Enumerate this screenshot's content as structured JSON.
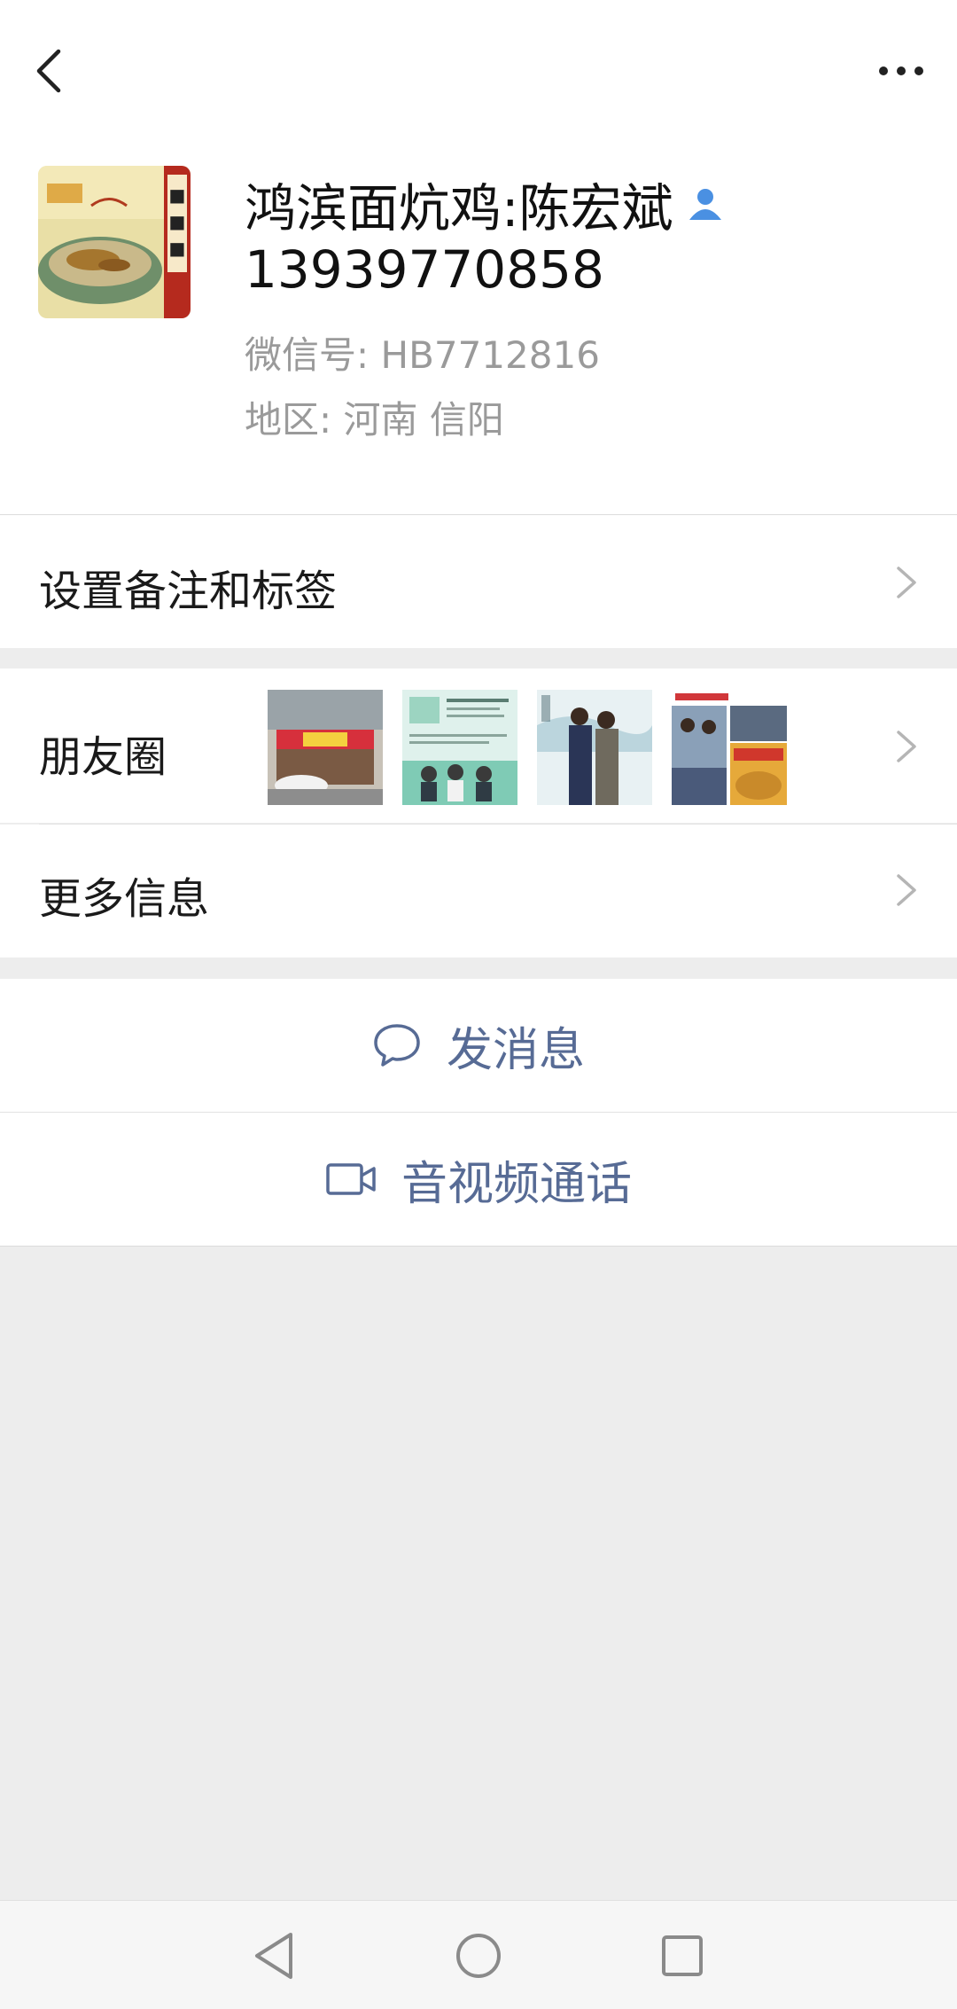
{
  "header": {
    "back_icon": "back-chevron-icon",
    "more_icon": "more-dots-icon"
  },
  "profile": {
    "name": "鸿滨面炕鸡:陈宏斌",
    "phone": "13939770858",
    "wechat_id": "微信号: HB7712816",
    "region": "地区: 河南  信阳",
    "verify_icon": "contact-person-icon"
  },
  "rows": {
    "remark_label": "设置备注和标签",
    "moments_label": "朋友圈",
    "more_info_label": "更多信息"
  },
  "actions": {
    "message_label": "发消息",
    "call_label": "音视频通话"
  },
  "colors": {
    "link_blue": "#576b95",
    "verify_blue": "#4a90e2",
    "background": "#ededed"
  }
}
